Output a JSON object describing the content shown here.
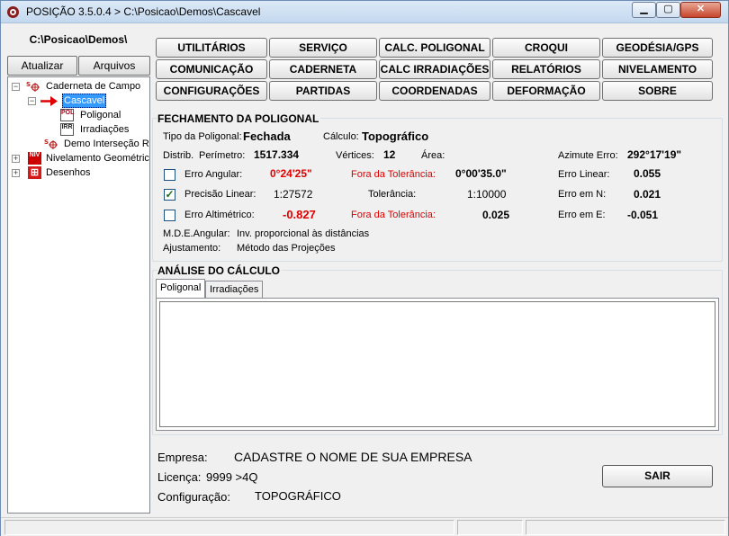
{
  "window": {
    "title": "POSIÇÃO 3.5.0.4 > C:\\Posicao\\Demos\\Cascavel",
    "minimize": "▁",
    "maximize": "▢",
    "close": "✕"
  },
  "left": {
    "path": "C:\\Posicao\\Demos\\",
    "atualizar": "Atualizar",
    "arquivos": "Arquivos",
    "tree": [
      {
        "label": "Caderneta de Campo",
        "icon": "survey-book-icon",
        "expander": "−"
      },
      {
        "label": "Cascavel",
        "icon": "red-arrow-icon",
        "expander": "−",
        "selected": true
      },
      {
        "label": "Poligonal",
        "icon": "pol-icon",
        "icon_text": "POL"
      },
      {
        "label": "Irradiações",
        "icon": "irr-icon",
        "icon_text": "IRR"
      },
      {
        "label": "Demo Interseção Re",
        "icon": "survey-book-icon"
      },
      {
        "label": "Nivelamento Geométrico",
        "icon": "niv-icon",
        "icon_text": "NIV",
        "expander": "+"
      },
      {
        "label": "Desenhos",
        "icon": "drawing-icon",
        "icon_text": "⊞",
        "expander": "+"
      }
    ]
  },
  "menu": {
    "row1": [
      "UTILITÁRIOS",
      "SERVIÇO",
      "CALC. POLIGONAL",
      "CROQUI",
      "GEODÉSIA/GPS"
    ],
    "row2": [
      "COMUNICAÇÃO",
      "CADERNETA",
      "CALC IRRADIAÇÕES",
      "RELATÓRIOS",
      "NIVELAMENTO"
    ],
    "row3": [
      "CONFIGURAÇÕES",
      "PARTIDAS",
      "COORDENADAS",
      "DEFORMAÇÃO",
      "SOBRE"
    ]
  },
  "fechamento": {
    "title": "FECHAMENTO DA POLIGONAL",
    "tipo_label": "Tipo da Poligonal:",
    "tipo_value": "Fechada",
    "calculo_label": "Cálculo:",
    "calculo_value": "Topográfico",
    "distrib_label": "Distrib.",
    "perimetro_label": "Perímetro:",
    "perimetro_value": "1517.334",
    "vertices_label": "Vértices:",
    "vertices_value": "12",
    "area_label": "Área:",
    "azimute_label": "Azimute Erro:",
    "azimute_value": "292°17'19\"",
    "erro_angular_label": "Erro Angular:",
    "erro_angular_value": "0°24'25\"",
    "erro_angular_checked": false,
    "fora_tol_1": "Fora da Tolerância:",
    "tol_angular_value": "0°00'35.0\"",
    "erro_linear_label": "Erro Linear:",
    "erro_linear_value": "0.055",
    "precisao_label": "Precisão Linear:",
    "precisao_value": "1:27572",
    "precisao_checked": true,
    "tolerancia_label": "Tolerância:",
    "tolerancia_value": "1:10000",
    "erro_n_label": "Erro em N:",
    "erro_n_value": "0.021",
    "erro_alt_label": "Erro Altimétrico:",
    "erro_alt_value": "-0.827",
    "erro_alt_checked": false,
    "fora_tol_2": "Fora da Tolerância:",
    "tol_alt_value": "0.025",
    "erro_e_label": "Erro em E:",
    "erro_e_value": "-0.051",
    "mde_label": "M.D.E.Angular:",
    "mde_value": "Inv. proporcional às distâncias",
    "ajuste_label": "Ajustamento:",
    "ajuste_value": "Método das Projeções"
  },
  "analise": {
    "title": "ANÁLISE DO CÁLCULO",
    "tabs": [
      "Poligonal",
      "Irradiações"
    ],
    "active_tab": 0,
    "content": ""
  },
  "footer": {
    "empresa_label": "Empresa:",
    "empresa_value": "CADASTRE O NOME DE SUA EMPRESA",
    "licenca_label": "Licença:",
    "licenca_value": "9999 >4Q",
    "config_label": "Configuração:",
    "config_value": "TOPOGRÁFICO",
    "sair": "SAIR"
  },
  "colors": {
    "error_red": "#e00000",
    "selection_blue": "#3399ff",
    "check_green": "#1b6e1b"
  }
}
